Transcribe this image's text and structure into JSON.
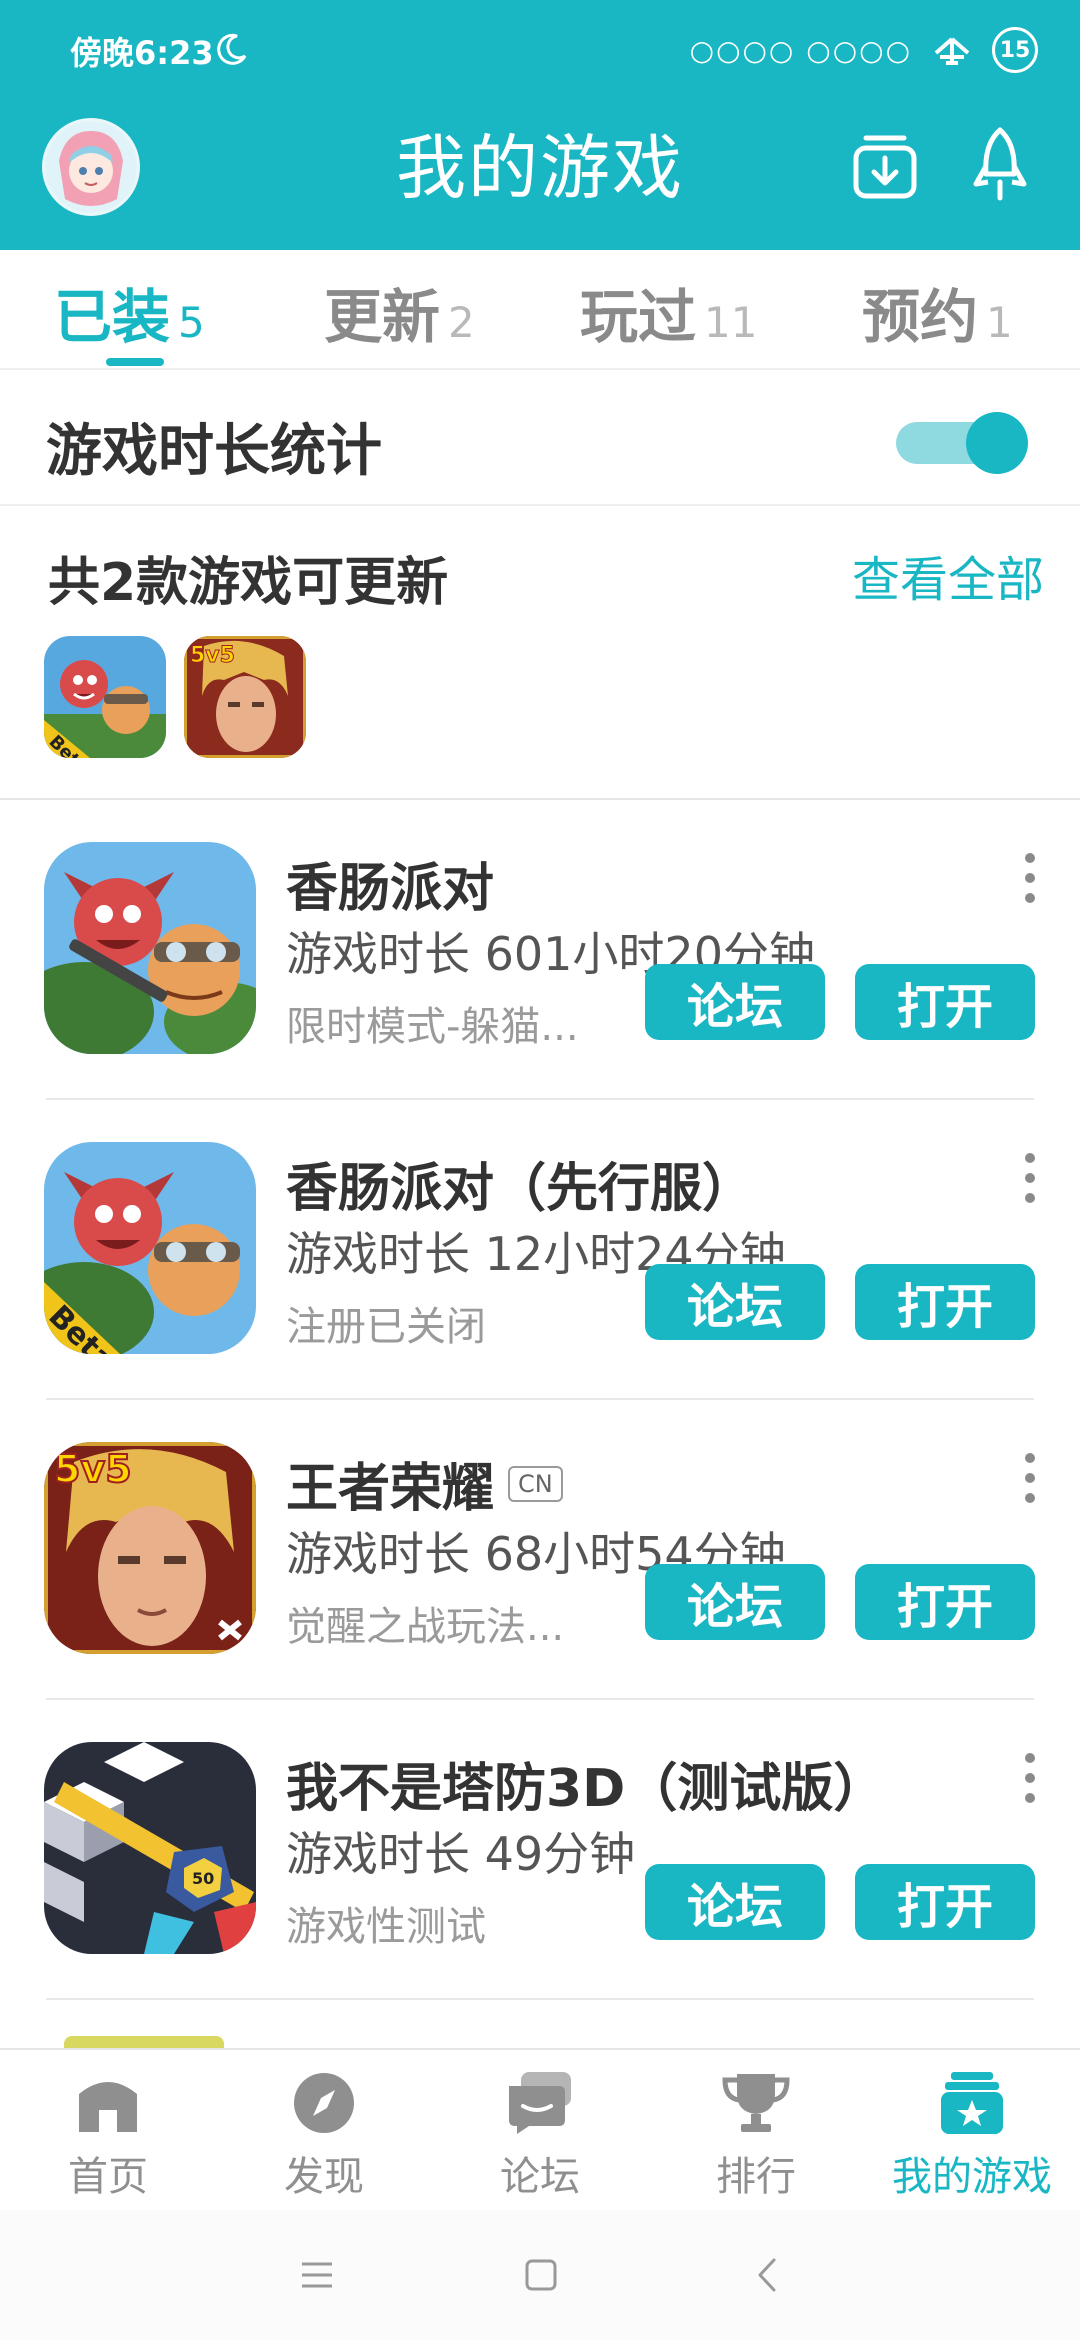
{
  "status_bar": {
    "time": "傍晚6:23",
    "signal": "○○○○ ○○○○",
    "battery": "15"
  },
  "header": {
    "title": "我的游戏"
  },
  "tabs": [
    {
      "label": "已装",
      "count": "5"
    },
    {
      "label": "更新",
      "count": "2"
    },
    {
      "label": "玩过",
      "count": "11"
    },
    {
      "label": "预约",
      "count": "1"
    }
  ],
  "stats": {
    "label": "游戏时长统计",
    "toggle_on": true
  },
  "updates": {
    "title": "共2款游戏可更新",
    "view_all": "查看全部"
  },
  "games": [
    {
      "name": "香肠派对",
      "time": "游戏时长 601小时20分钟",
      "desc": "限时模式-躲猫...",
      "forum": "论坛",
      "open": "打开"
    },
    {
      "name": "香肠派对（先行服）",
      "time": "游戏时长 12小时24分钟",
      "desc": "注册已关闭",
      "forum": "论坛",
      "open": "打开"
    },
    {
      "name": "王者荣耀",
      "badge": "CN",
      "time": "游戏时长 68小时54分钟",
      "desc": "觉醒之战玩法...",
      "forum": "论坛",
      "open": "打开"
    },
    {
      "name": "我不是塔防3D（测试版）",
      "time": "游戏时长 49分钟",
      "desc": "游戏性测试",
      "forum": "论坛",
      "open": "打开"
    }
  ],
  "bottom_nav": [
    {
      "label": "首页",
      "icon": "home-icon"
    },
    {
      "label": "发现",
      "icon": "compass-icon"
    },
    {
      "label": "论坛",
      "icon": "chat-icon"
    },
    {
      "label": "排行",
      "icon": "trophy-icon"
    },
    {
      "label": "我的游戏",
      "icon": "game-box-icon",
      "active": true
    }
  ],
  "colors": {
    "accent": "#19b6c4",
    "text": "#333333",
    "muted": "#9a9a9a"
  }
}
